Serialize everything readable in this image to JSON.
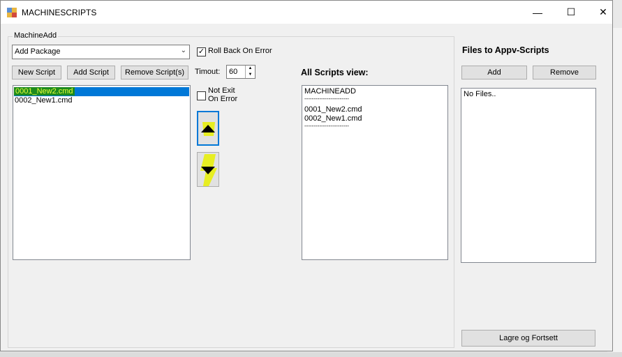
{
  "window": {
    "title": "MACHINESCRIPTS",
    "min": "—",
    "max": "☐",
    "close": "✕"
  },
  "group": {
    "label": "MachineAdd"
  },
  "package_select": {
    "value": "Add Package"
  },
  "buttons": {
    "new_script": "New Script",
    "add_script": "Add Script",
    "remove_script": "Remove Script(s)"
  },
  "rollback": {
    "label": "Roll Back On Error",
    "checked": true,
    "mark": "✓"
  },
  "timeout": {
    "label": "Timout:",
    "value": "60"
  },
  "not_exit": {
    "line1": "Not Exit",
    "line2": "On Error",
    "checked": false
  },
  "scripts_list": {
    "items": [
      "0001_New2.cmd",
      "0002_New1.cmd"
    ],
    "selected": "0001_New2.cmd"
  },
  "all_scripts": {
    "header": "All Scripts view:",
    "lines": [
      "MACHINEADD",
      "------------------------",
      "",
      "0001_New2.cmd",
      "0002_New1.cmd",
      "------------------------"
    ]
  },
  "files": {
    "header": "Files to Appv-Scripts",
    "add": "Add",
    "remove": "Remove",
    "list_text": "No Files..",
    "save": "Lagre og Fortsett"
  },
  "colors": {
    "selection": "#0078d7",
    "highlight": "#e8f000",
    "titlebar": "#ffffff"
  }
}
